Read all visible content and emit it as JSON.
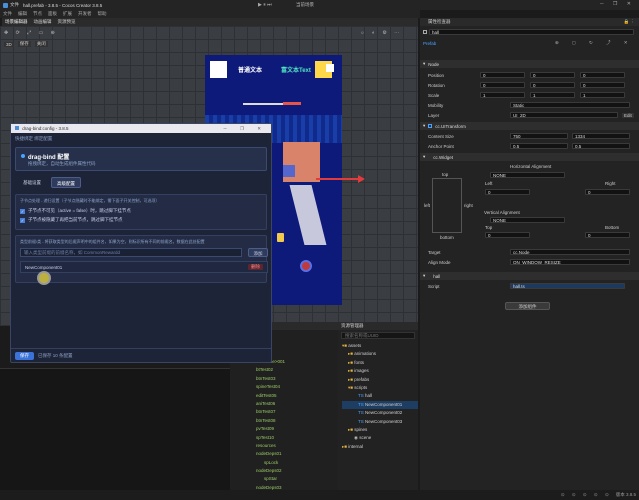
{
  "titlebar": {
    "menu_label": "文件",
    "title": "hall.prefab - 3.8.5 - Cocos Creator 3.8.5",
    "center_tool": "当前场景"
  },
  "menubar": {
    "items": [
      "文件",
      "编辑",
      "节点",
      "面板",
      "扩展",
      "开发者",
      "帮助"
    ]
  },
  "left_tabs": [
    "场景编辑器",
    "动画编辑",
    "资源预览"
  ],
  "scene": {
    "toolbar": [
      "3D",
      "保存",
      "关闭"
    ],
    "phone": {
      "rich_text_plain": "普通文本",
      "rich_text_colored": "富文本Text"
    }
  },
  "inspector": {
    "title": "属性检查器",
    "node_name": "hall",
    "prefab_label": "Prefab",
    "node_section": "Node",
    "props": [
      {
        "label": "Position",
        "x": "0",
        "y": "0",
        "z": "0"
      },
      {
        "label": "Rotation",
        "x": "0",
        "y": "0",
        "z": "0"
      },
      {
        "label": "Scale",
        "x": "1",
        "y": "1",
        "z": "1"
      }
    ],
    "mobility_label": "Mobility",
    "mobility": "Static",
    "layer_label": "Layer",
    "layer": "UI_2D",
    "edit_label": "Edit",
    "uitransform": "cc.UITransform",
    "content_size_label": "Content Size",
    "content_w": "750",
    "content_h": "1334",
    "anchor_label": "Anchor Point",
    "anchor_x": "0.5",
    "anchor_y": "0.5",
    "widget": "cc.Widget",
    "halign_label": "Horizontal Alignment",
    "valign_label": "Vertical Alignment",
    "h_none": "NONE",
    "v_none": "NONE",
    "left_label": "Left",
    "right_label": "Right",
    "top_label": "Top",
    "bottom_label": "Bottom",
    "top_small": "top",
    "bottom_small": "bottom",
    "left_small": "left",
    "right_small": "right",
    "left_val": "0",
    "right_val": "0",
    "top_val": "0",
    "bottom_val": "0",
    "px": "px",
    "target_label": "Target",
    "target_val": "cc.Node",
    "align_mode_label": "Align Mode",
    "align_mode": "ON_WINDOW_RESIZE",
    "hall_component": "hall",
    "script_label": "Script",
    "script_val": "hall.ts",
    "add_component": "添加组件"
  },
  "console": {
    "title": "层级管理器",
    "items": [
      "<noname>001",
      "btTest02",
      "btnTest03",
      "spineTest04",
      "editTest05",
      "aniTest06",
      "btnTest07",
      "btnTest08",
      "pvTest09",
      "spTest10",
      "resources",
      "nodeDeps01",
      "spLock",
      "nodeDeps02",
      "spStar",
      "nodeDeps03",
      "spWheel"
    ]
  },
  "assets": {
    "title": "资源管理器",
    "search_placeholder": "搜索名称或UUID",
    "items": [
      {
        "icon": "folder",
        "name": "assets"
      },
      {
        "icon": "folder",
        "name": "animations"
      },
      {
        "icon": "folder",
        "name": "fonts"
      },
      {
        "icon": "folder",
        "name": "images"
      },
      {
        "icon": "folder",
        "name": "prefabs"
      },
      {
        "icon": "folder",
        "name": "scripts"
      },
      {
        "icon": "ts",
        "name": "hall"
      },
      {
        "icon": "ts",
        "name": "NewComponent01"
      },
      {
        "icon": "ts",
        "name": "NewComponent02"
      },
      {
        "icon": "ts",
        "name": "NewComponent03"
      },
      {
        "icon": "folder",
        "name": "spines"
      },
      {
        "icon": "scene",
        "name": "scene"
      },
      {
        "icon": "folder",
        "name": "internal"
      }
    ]
  },
  "dialog": {
    "title": "drag-bind:config - 3.8.5",
    "breadcrumb": "快捷绑定  绑定配置",
    "header_title": "drag-bind 配置",
    "header_sub": "拖拽绑定，自动生成组件属性代码",
    "tab_basic": "基础设置",
    "tab_advanced": "高级配置",
    "section1_title": "子节点处理 - 递归设置（子节点隐藏时不能绑定，需下面子开关控制，可选项）",
    "check1": "子节点不可见（active = false）时，跳过脚下挂节点",
    "check2": "子节点被隐藏了再把当前节点，跳过脚下挂节点",
    "section2_title": "类型前缀/类 - 将获取类型的后缀声明中的组件名，如果为空，则标识所有不同的前缀名。数据在此处配置",
    "input_placeholder": "输入类型前缀的前缀名称，如 CommonRewardd",
    "add_label": "添加",
    "row_label": "NewComponent01",
    "delete_label": "删除",
    "save_label": "保存",
    "save_status": "已保存 10 条配置"
  },
  "statusbar": {
    "version": "版本 3.8.5"
  }
}
